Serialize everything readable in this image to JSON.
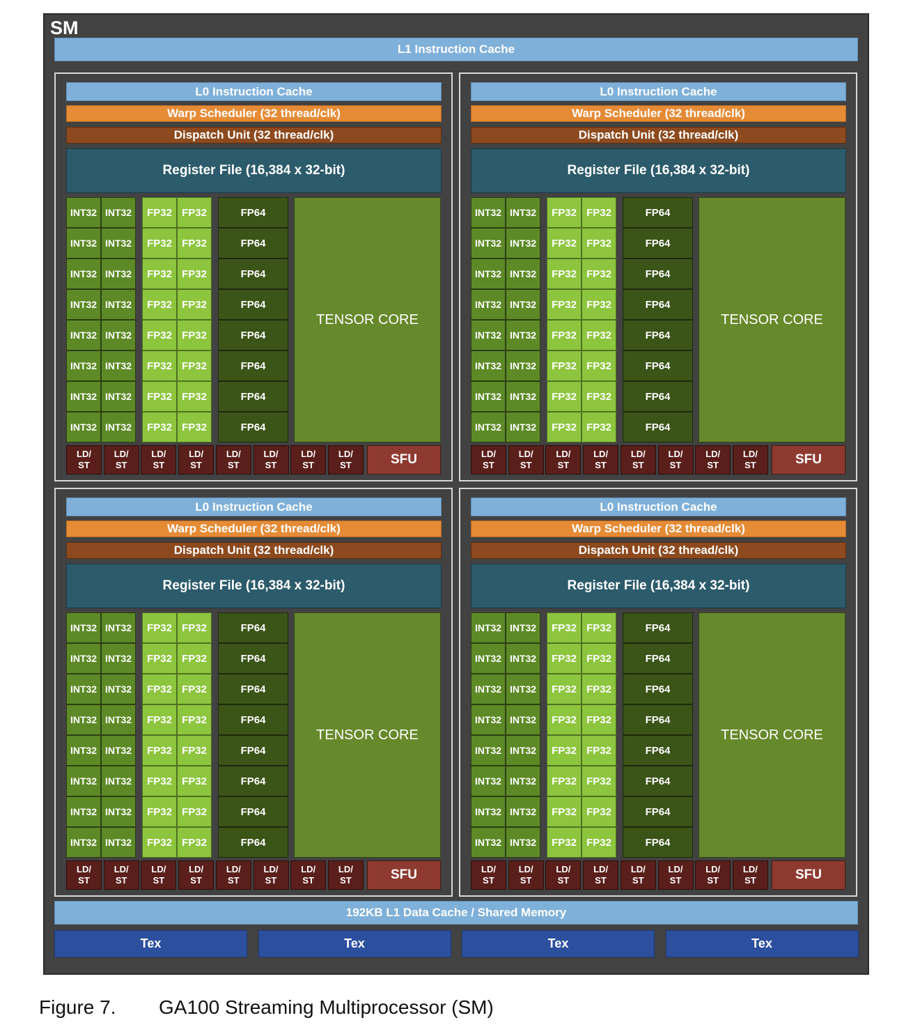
{
  "sm": {
    "title": "SM",
    "l1_instruction_cache": "L1 Instruction Cache",
    "l1_data_cache": "192KB L1 Data Cache / Shared Memory",
    "tex_label": "Tex",
    "tex_count": 4
  },
  "subcore": {
    "count": 4,
    "l0_cache": "L0 Instruction Cache",
    "warp_scheduler": "Warp Scheduler (32 thread/clk)",
    "dispatch_unit": "Dispatch Unit (32 thread/clk)",
    "register_file": "Register File (16,384 x 32-bit)",
    "int32_label": "INT32",
    "fp32_label": "FP32",
    "fp64_label": "FP64",
    "rows": 8,
    "tensor_core": "TENSOR CORE",
    "ldst_label_top": "LD/",
    "ldst_label_bottom": "ST",
    "ldst_count": 8,
    "sfu": "SFU"
  },
  "caption": {
    "number": "Figure 7.",
    "text": "GA100 Streaming Multiprocessor (SM)"
  },
  "colors": {
    "background": "#424242",
    "l0_l1_cache": "#7fb0d9",
    "warp_scheduler": "#e58b36",
    "dispatch_unit": "#8c4a1e",
    "register_file": "#2c5b6b",
    "int32": "#5d8a26",
    "fp32": "#8dc53e",
    "fp64": "#3b5418",
    "tensor_core": "#66892b",
    "ldst": "#5a1f1b",
    "sfu": "#8e3a30",
    "tex": "#2c4f9e"
  }
}
